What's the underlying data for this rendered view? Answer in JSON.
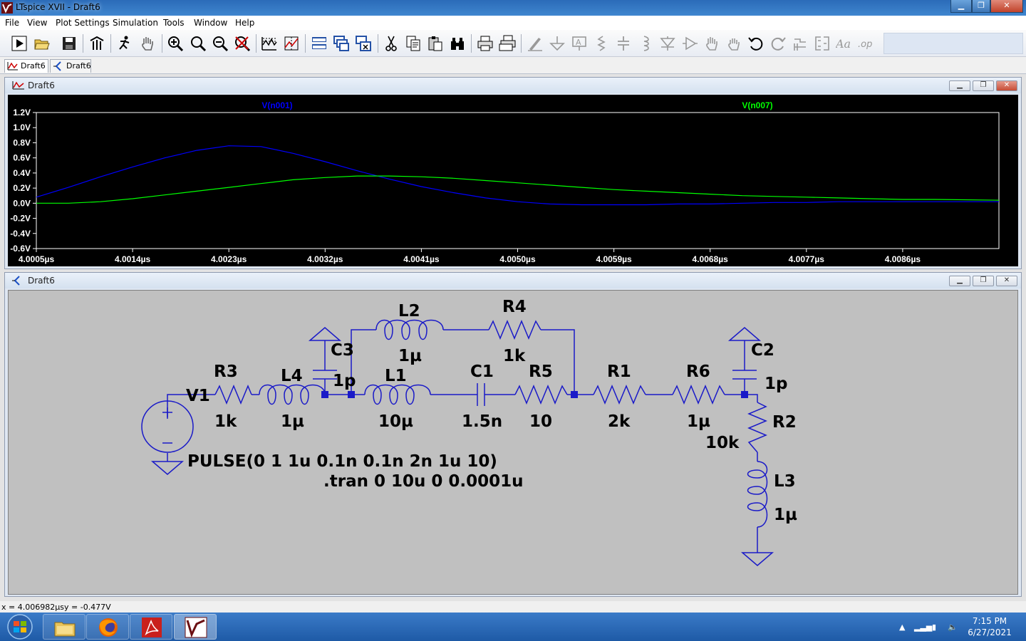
{
  "window": {
    "title": "LTspice XVII - Draft6"
  },
  "menu": [
    "File",
    "View",
    "Plot Settings",
    "Simulation",
    "Tools",
    "Window",
    "Help"
  ],
  "toolbar": {
    "icons": [
      "run-icon",
      "open-icon",
      "save-icon",
      "control-panel-icon",
      "halt-icon",
      "pan-hand-icon",
      "zoom-in-icon",
      "zoom-area-icon",
      "zoom-out-icon",
      "zoom-cancel-icon",
      "autorange-icon",
      "mark-icon",
      "tile-icon",
      "cascade-icon",
      "close-all-icon",
      "cut-icon",
      "copy-icon",
      "paste-icon",
      "find-icon",
      "print-icon",
      "print-setup-icon",
      "wire-icon",
      "ground-icon",
      "label-icon",
      "resistor-icon",
      "capacitor-icon",
      "inductor-icon",
      "diode-icon",
      "component-icon",
      "move-icon",
      "drag-icon",
      "undo-icon",
      "redo-icon",
      "rotate-icon",
      "mirror-icon",
      "text-icon",
      "spice-directive-icon"
    ]
  },
  "tabs": [
    {
      "label": "Draft6",
      "icon": "waveform-icon",
      "active": true
    },
    {
      "label": "Draft6",
      "icon": "schematic-icon",
      "active": false
    }
  ],
  "wave_window": {
    "title": "Draft6"
  },
  "schematic_window": {
    "title": "Draft6"
  },
  "chart_data": {
    "type": "line",
    "series": [
      {
        "name": "V(n001)",
        "color": "#0000ff",
        "x": [
          4.0005,
          4.0008,
          4.0011,
          4.0014,
          4.0017,
          4.002,
          4.0023,
          4.0026,
          4.0029,
          4.0032,
          4.0035,
          4.0038,
          4.0041,
          4.0044,
          4.0047,
          4.005,
          4.0053,
          4.0056,
          4.0059,
          4.0062,
          4.0065,
          4.0068,
          4.0071,
          4.0074,
          4.0077,
          4.008,
          4.0083,
          4.0086,
          4.0089,
          4.0095
        ],
        "y": [
          0.08,
          0.21,
          0.35,
          0.48,
          0.6,
          0.7,
          0.76,
          0.75,
          0.66,
          0.55,
          0.43,
          0.32,
          0.22,
          0.14,
          0.07,
          0.02,
          -0.01,
          -0.02,
          -0.02,
          -0.02,
          -0.01,
          -0.01,
          0.0,
          0.01,
          0.01,
          0.02,
          0.02,
          0.02,
          0.02,
          0.02
        ]
      },
      {
        "name": "V(n007)",
        "color": "#00ff00",
        "x": [
          4.0005,
          4.0008,
          4.0011,
          4.0014,
          4.0017,
          4.002,
          4.0023,
          4.0026,
          4.0029,
          4.0032,
          4.0035,
          4.0038,
          4.0041,
          4.0044,
          4.0047,
          4.005,
          4.0053,
          4.0056,
          4.0059,
          4.0062,
          4.0065,
          4.0068,
          4.0071,
          4.0074,
          4.0077,
          4.008,
          4.0083,
          4.0086,
          4.0089,
          4.0095
        ],
        "y": [
          0.0,
          0.0,
          0.02,
          0.06,
          0.11,
          0.16,
          0.21,
          0.26,
          0.31,
          0.34,
          0.36,
          0.36,
          0.35,
          0.33,
          0.3,
          0.27,
          0.24,
          0.21,
          0.18,
          0.16,
          0.14,
          0.12,
          0.1,
          0.09,
          0.08,
          0.07,
          0.06,
          0.05,
          0.05,
          0.04
        ]
      }
    ],
    "xlim": [
      4.0005,
      4.0095
    ],
    "ylim": [
      -0.6,
      1.2
    ],
    "yticks": [
      "1.2V",
      "1.0V",
      "0.8V",
      "0.6V",
      "0.4V",
      "0.2V",
      "0.0V",
      "-0.2V",
      "-0.4V",
      "-0.6V"
    ],
    "xticks": [
      "4.0005µs",
      "4.0014µs",
      "4.0023µs",
      "4.0032µs",
      "4.0041µs",
      "4.0050µs",
      "4.0059µs",
      "4.0068µs",
      "4.0077µs",
      "4.0086µs"
    ],
    "grid": false
  },
  "schematic": {
    "components": [
      {
        "ref": "V1",
        "value": "PULSE(0 1 1u 0.1n 0.1n 2n 1u 10)"
      },
      {
        "ref": "R3",
        "value": "1k"
      },
      {
        "ref": "L4",
        "value": "1µ"
      },
      {
        "ref": "C3",
        "value": "1p"
      },
      {
        "ref": "L2",
        "value": "1µ"
      },
      {
        "ref": "R4",
        "value": "1k"
      },
      {
        "ref": "L1",
        "value": "10µ"
      },
      {
        "ref": "C1",
        "value": "1.5n"
      },
      {
        "ref": "R5",
        "value": "10"
      },
      {
        "ref": "R1",
        "value": "2k"
      },
      {
        "ref": "R6",
        "value": "1µ"
      },
      {
        "ref": "C2",
        "value": "1p"
      },
      {
        "ref": "R2",
        "value": "10k"
      },
      {
        "ref": "L3",
        "value": "1µ"
      }
    ],
    "directive": ".tran 0 10u 0 0.0001u"
  },
  "status": {
    "x": "x = 4.006982µs",
    "y": "y = -0.477V"
  },
  "taskbar": {
    "apps": [
      "start-orb-icon",
      "file-explorer-icon",
      "firefox-icon",
      "acrobat-icon",
      "ltspice-icon"
    ],
    "time": "7:15 PM",
    "date": "6/27/2021"
  }
}
